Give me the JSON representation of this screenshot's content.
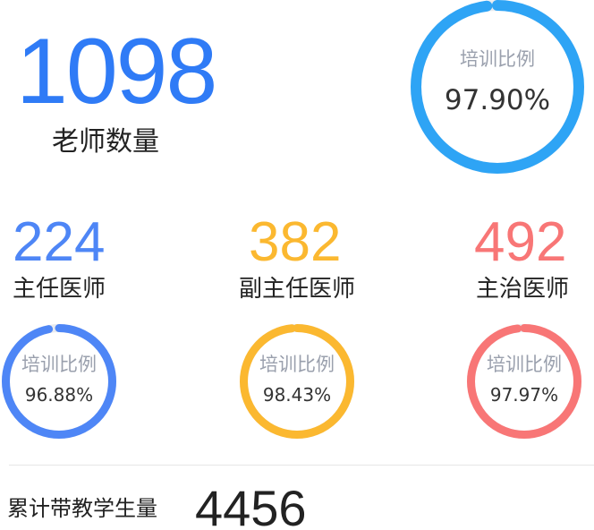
{
  "summary": {
    "teacher_count": "1098",
    "teacher_label": "老师数量",
    "ring": {
      "title": "培训比例",
      "value": "97.90%",
      "fraction": 0.979,
      "color": "#2ea4f5"
    }
  },
  "categories": [
    {
      "count": "224",
      "label": "主任医师",
      "color": "#4e86f6",
      "ring": {
        "title": "培训比例",
        "value": "96.88%",
        "fraction": 0.9688
      }
    },
    {
      "count": "382",
      "label": "副主任医师",
      "color": "#fbb830",
      "ring": {
        "title": "培训比例",
        "value": "98.43%",
        "fraction": 0.9843
      }
    },
    {
      "count": "492",
      "label": "主治医师",
      "color": "#f87676",
      "ring": {
        "title": "培训比例",
        "value": "97.97%",
        "fraction": 0.9797
      }
    }
  ],
  "students": {
    "label": "累计带教学生量",
    "count": "4456"
  },
  "colors": {
    "primary_blue": "#2f7bf6",
    "ring_track": "#e8eaee"
  }
}
